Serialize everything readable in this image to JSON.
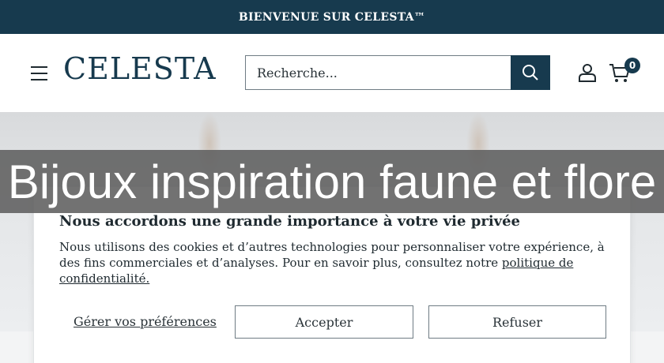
{
  "announcement": "BIENVENUE SUR CELESTA™",
  "header": {
    "logo": "CELESTA",
    "search_placeholder": "Recherche...",
    "cart_count": "0"
  },
  "hero": {
    "banner_title": "Bijoux inspiration faune et flore"
  },
  "cookie": {
    "title": "Nous accordons une grande importance à votre vie privée",
    "text": "Nous utilisons des cookies et d’autres technologies pour personnaliser votre expérience, à des fins commerciales et d’analyses. Pour en savoir plus, consultez notre ",
    "policy_link": "politique de confidentialité.",
    "manage_label": "Gérer vos préférences",
    "accept_label": "Accepter",
    "refuse_label": "Refuser"
  },
  "colors": {
    "brand": "#173a4e",
    "banner": "#5f5f5f"
  },
  "icons": {
    "menu": "hamburger-icon",
    "search": "search-icon",
    "account": "user-icon",
    "cart": "cart-icon"
  }
}
